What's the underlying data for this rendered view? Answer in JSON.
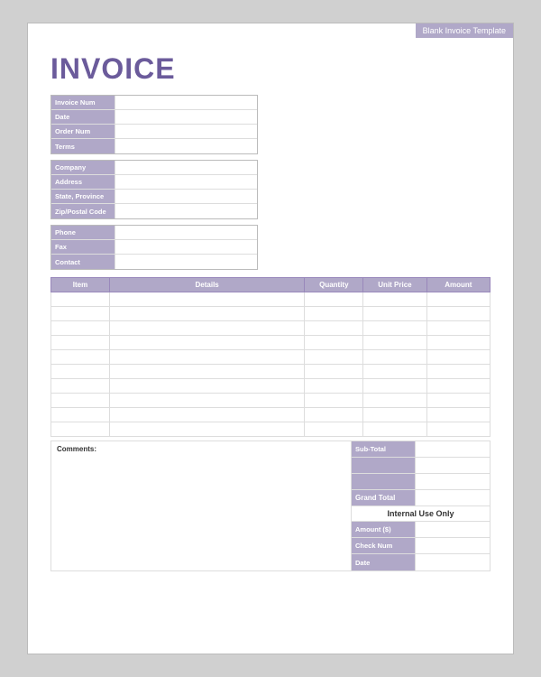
{
  "template": {
    "label": "Blank Invoice Template"
  },
  "header": {
    "title": "INVOICE"
  },
  "info": {
    "invoice_num_label": "Invoice Num",
    "date_label": "Date",
    "order_num_label": "Order Num",
    "terms_label": "Terms"
  },
  "address": {
    "company_label": "Company",
    "address_label": "Address",
    "state_label": "State, Province",
    "zip_label": "Zip/Postal Code"
  },
  "contact": {
    "phone_label": "Phone",
    "fax_label": "Fax",
    "contact_label": "Contact"
  },
  "table": {
    "col_item": "Item",
    "col_details": "Details",
    "col_qty": "Quantity",
    "col_price": "Unit Price",
    "col_amount": "Amount",
    "rows": [
      {},
      {},
      {},
      {},
      {},
      {},
      {},
      {},
      {},
      {}
    ]
  },
  "bottom": {
    "comments_label": "Comments:",
    "subtotal_label": "Sub-Total",
    "grand_total_label": "Grand Total",
    "internal_use_label": "Internal Use Only",
    "amount_label": "Amount ($)",
    "check_num_label": "Check Num",
    "date_label": "Date"
  }
}
